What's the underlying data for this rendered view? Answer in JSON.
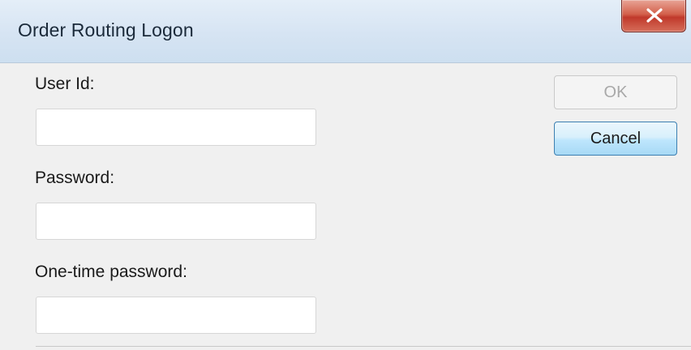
{
  "window": {
    "title": "Order Routing Logon",
    "close_icon": "close-x-icon"
  },
  "form": {
    "user_id_label": "User Id:",
    "user_id_value": "",
    "password_label": "Password:",
    "password_value": "",
    "otp_label": "One-time password:",
    "otp_value": ""
  },
  "buttons": {
    "ok_label": "OK",
    "ok_enabled": false,
    "cancel_label": "Cancel"
  },
  "colors": {
    "close_button": "#c0392b",
    "cancel_border": "#3c7fb1",
    "disabled_text": "#a8a8a8"
  }
}
